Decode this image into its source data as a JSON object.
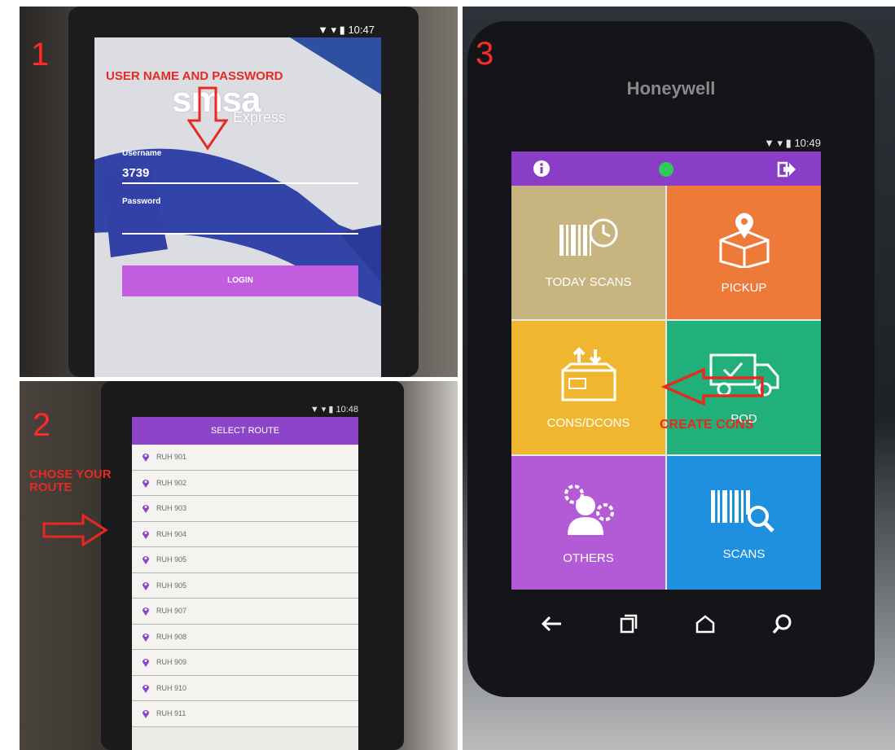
{
  "steps": [
    "1",
    "2",
    "3"
  ],
  "annotations": {
    "panel1": "USER NAME AND PASSWORD",
    "panel2": "CHOSE YOUR ROUTE",
    "panel3": "CREATE CONS"
  },
  "panel1": {
    "status_time": "10:47",
    "logo_text": "smsa",
    "logo_sub": "Express",
    "username_label": "Username",
    "username_value": "3739",
    "password_label": "Password",
    "login_label": "LOGIN"
  },
  "panel2": {
    "status_time": "10:48",
    "header": "SELECT ROUTE",
    "routes": [
      "RUH 901",
      "RUH 902",
      "RUH 903",
      "RUH 904",
      "RUH 905",
      "RUH 905",
      "RUH 907",
      "RUH 908",
      "RUH 909",
      "RUH 910",
      "RUH 911"
    ]
  },
  "panel3": {
    "brand": "Honeywell",
    "status_time": "10:49",
    "tiles": [
      {
        "label": "TODAY SCANS",
        "color": "#c8b47e",
        "icon": "barcode-clock-icon"
      },
      {
        "label": "PICKUP",
        "color": "#ee7a3a",
        "icon": "box-pin-icon"
      },
      {
        "label": "CONS/DCONS",
        "color": "#f1b62f",
        "icon": "box-arrows-icon"
      },
      {
        "label": "POD",
        "color": "#22b07a",
        "icon": "truck-icon"
      },
      {
        "label": "OTHERS",
        "color": "#b35bd6",
        "icon": "people-gear-icon"
      },
      {
        "label": "SCANS",
        "color": "#1f90e0",
        "icon": "barcode-search-icon"
      }
    ],
    "nav": [
      "back-icon",
      "recents-icon",
      "home-icon",
      "search-icon"
    ]
  },
  "colors": {
    "annotation": "#e52a22",
    "purple": "#8a3ec8"
  }
}
